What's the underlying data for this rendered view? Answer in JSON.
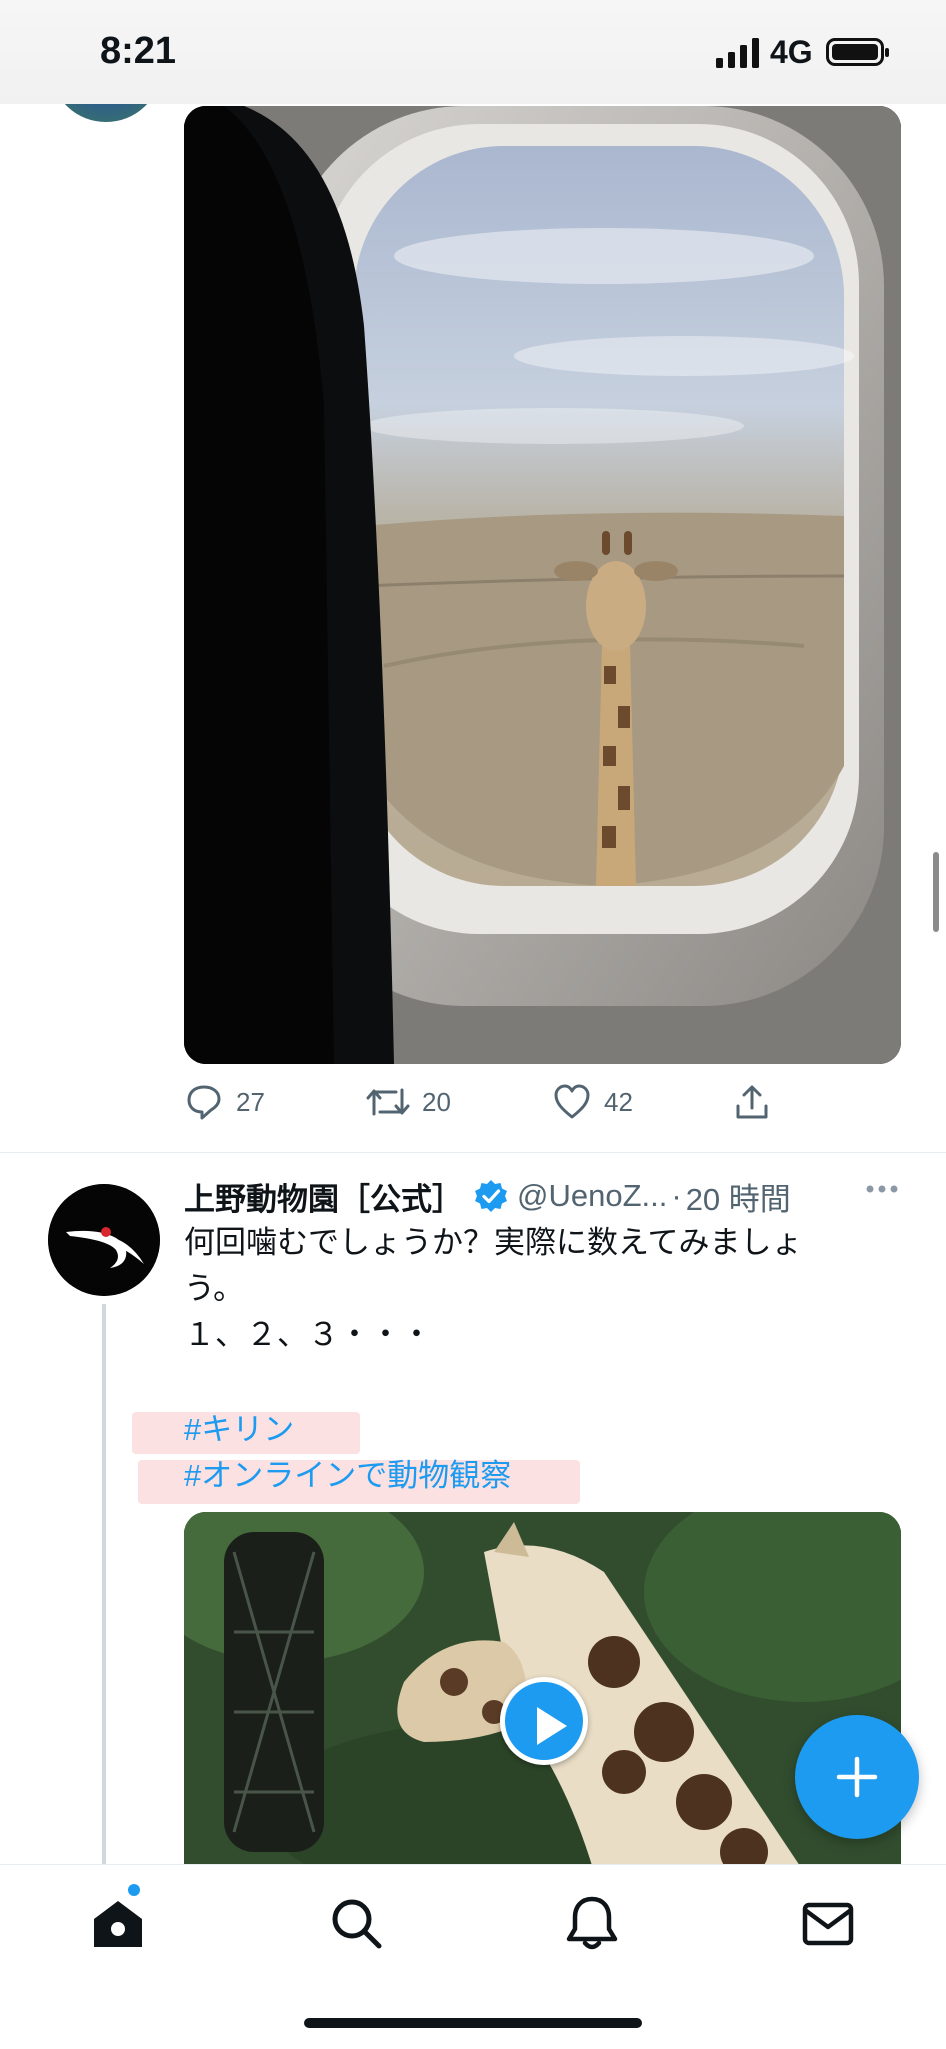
{
  "status_bar": {
    "time": "8:21",
    "network": "4G",
    "icons": [
      "cellular-signal-icon",
      "battery-icon"
    ]
  },
  "previous_tweet": {
    "actions": {
      "replies": "27",
      "retweets": "20",
      "likes": "42"
    },
    "icons": [
      "reply-icon",
      "retweet-icon",
      "like-icon",
      "share-icon"
    ]
  },
  "tweet": {
    "display_name": "上野動物園［公式］",
    "handle": "@UenoZ...",
    "separator": "·",
    "time": "20 時間",
    "text_lines": [
      "何回噛むでしょうか？実際に数えてみましょ",
      "う。",
      "１、２、３・・・"
    ],
    "hashtags": [
      "#キリン",
      "#オンラインで動物観察"
    ],
    "icons": [
      "verified-badge-icon",
      "more-icon",
      "play-icon"
    ]
  },
  "tab_bar": {
    "tabs": [
      "home",
      "search",
      "notifications",
      "messages"
    ],
    "icons": [
      "home-icon",
      "search-icon",
      "bell-icon",
      "mail-icon"
    ]
  },
  "colors": {
    "accent": "#1d9bf0",
    "text_primary": "#0f1419",
    "text_secondary": "#536471",
    "divider": "#e6ecf0"
  }
}
